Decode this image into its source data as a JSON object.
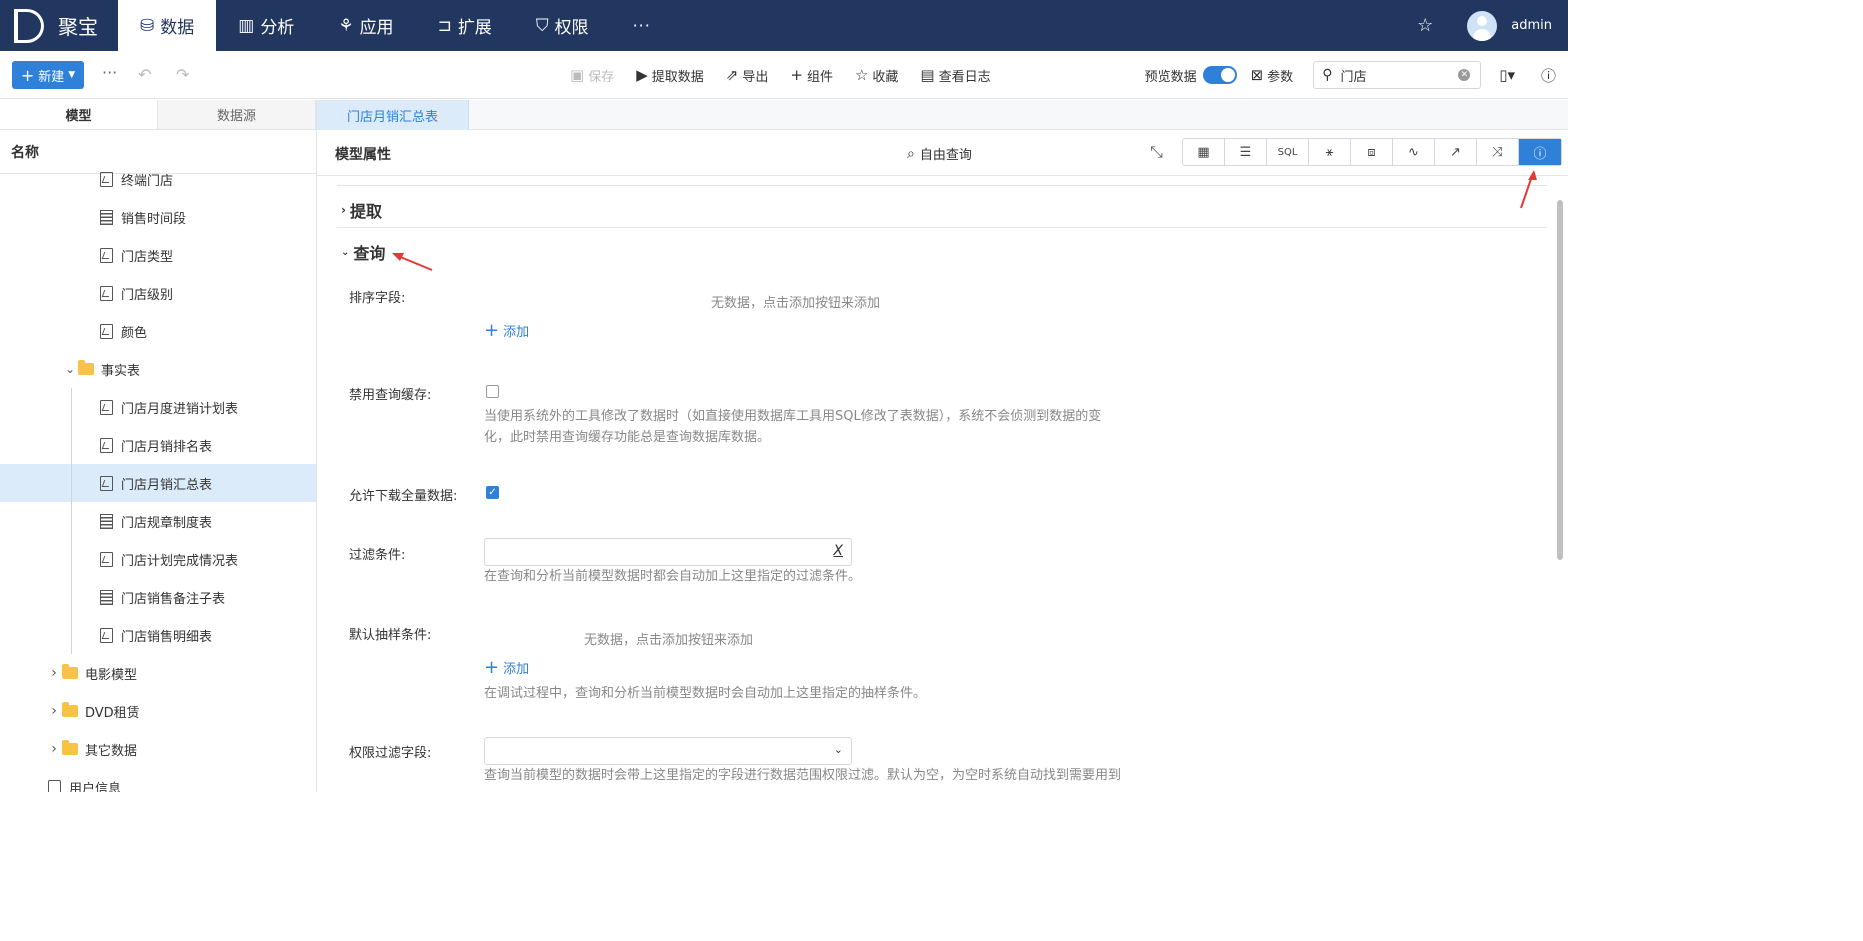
{
  "brand": {
    "name": "聚宝"
  },
  "nav": [
    {
      "label": "数据",
      "icon": "database-icon",
      "active": true
    },
    {
      "label": "分析",
      "icon": "bar-chart-icon"
    },
    {
      "label": "应用",
      "icon": "apps-icon"
    },
    {
      "label": "扩展",
      "icon": "extension-icon"
    },
    {
      "label": "权限",
      "icon": "shield-icon"
    }
  ],
  "nav_more": "···",
  "user": {
    "name": "admin"
  },
  "toolbar": {
    "new_label": "新建",
    "save": "保存",
    "extract": "提取数据",
    "export": "导出",
    "component": "组件",
    "favorite": "收藏",
    "log": "查看日志",
    "preview": "预览数据",
    "params": "参数",
    "search_value": "门店"
  },
  "left": {
    "tabs": [
      "模型",
      "数据源"
    ],
    "header": "名称",
    "tree": [
      {
        "label": "终端门店",
        "type": "model",
        "indent": 2
      },
      {
        "label": "销售时间段",
        "type": "table",
        "indent": 2
      },
      {
        "label": "门店类型",
        "type": "model",
        "indent": 2
      },
      {
        "label": "门店级别",
        "type": "model",
        "indent": 2
      },
      {
        "label": "颜色",
        "type": "model",
        "indent": 2
      },
      {
        "label": "事实表",
        "type": "folder",
        "indent": 1,
        "expanded": true
      },
      {
        "label": "门店月度进销计划表",
        "type": "model",
        "indent": 2
      },
      {
        "label": "门店月销排名表",
        "type": "model",
        "indent": 2
      },
      {
        "label": "门店月销汇总表",
        "type": "model",
        "indent": 2,
        "selected": true
      },
      {
        "label": "门店规章制度表",
        "type": "table",
        "indent": 2
      },
      {
        "label": "门店计划完成情况表",
        "type": "model",
        "indent": 2
      },
      {
        "label": "门店销售备注子表",
        "type": "table",
        "indent": 2
      },
      {
        "label": "门店销售明细表",
        "type": "model",
        "indent": 2
      },
      {
        "label": "电影模型",
        "type": "folder",
        "indent": 0
      },
      {
        "label": "DVD租赁",
        "type": "folder",
        "indent": 0
      },
      {
        "label": "其它数据",
        "type": "folder",
        "indent": 0
      },
      {
        "label": "用户信息",
        "type": "user",
        "indent": -1
      }
    ]
  },
  "content": {
    "tab": "门店月销汇总表",
    "title": "模型属性",
    "free_query": "自由查询",
    "view_buttons": [
      "table-view",
      "list-view",
      "SQL",
      "run-view",
      "graph-view",
      "pulse-view",
      "trend-view",
      "compare-view",
      "info-view"
    ],
    "sections": {
      "extract": "提取",
      "query": "查询"
    },
    "fields": {
      "sort_label": "排序字段:",
      "sort_empty": "无数据，点击添加按钮来添加",
      "add": "添加",
      "disable_cache_label": "禁用查询缓存:",
      "disable_cache_help": "当使用系统外的工具修改了数据时（如直接使用数据库工具用SQL修改了表数据），系统不会侦测到数据的变化，此时禁用查询缓存功能总是查询数据库数据。",
      "allow_download_label": "允许下载全量数据:",
      "filter_label": "过滤条件:",
      "filter_help": "在查询和分析当前模型数据时都会自动加上这里指定的过滤条件。",
      "sample_label": "默认抽样条件:",
      "sample_empty": "无数据，点击添加按钮来添加",
      "sample_help": "在调试过程中，查询和分析当前模型数据时会自动加上这里指定的抽样条件。",
      "perm_label": "权限过滤字段:",
      "perm_help": "查询当前模型的数据时会带上这里指定的字段进行数据范围权限过滤。默认为空，为空时系统自动找到需要用到"
    }
  },
  "colors": {
    "nav_bg": "#21375f",
    "accent": "#2f80d8",
    "selected_row": "#dcebfa",
    "annotation": "#e53935"
  }
}
